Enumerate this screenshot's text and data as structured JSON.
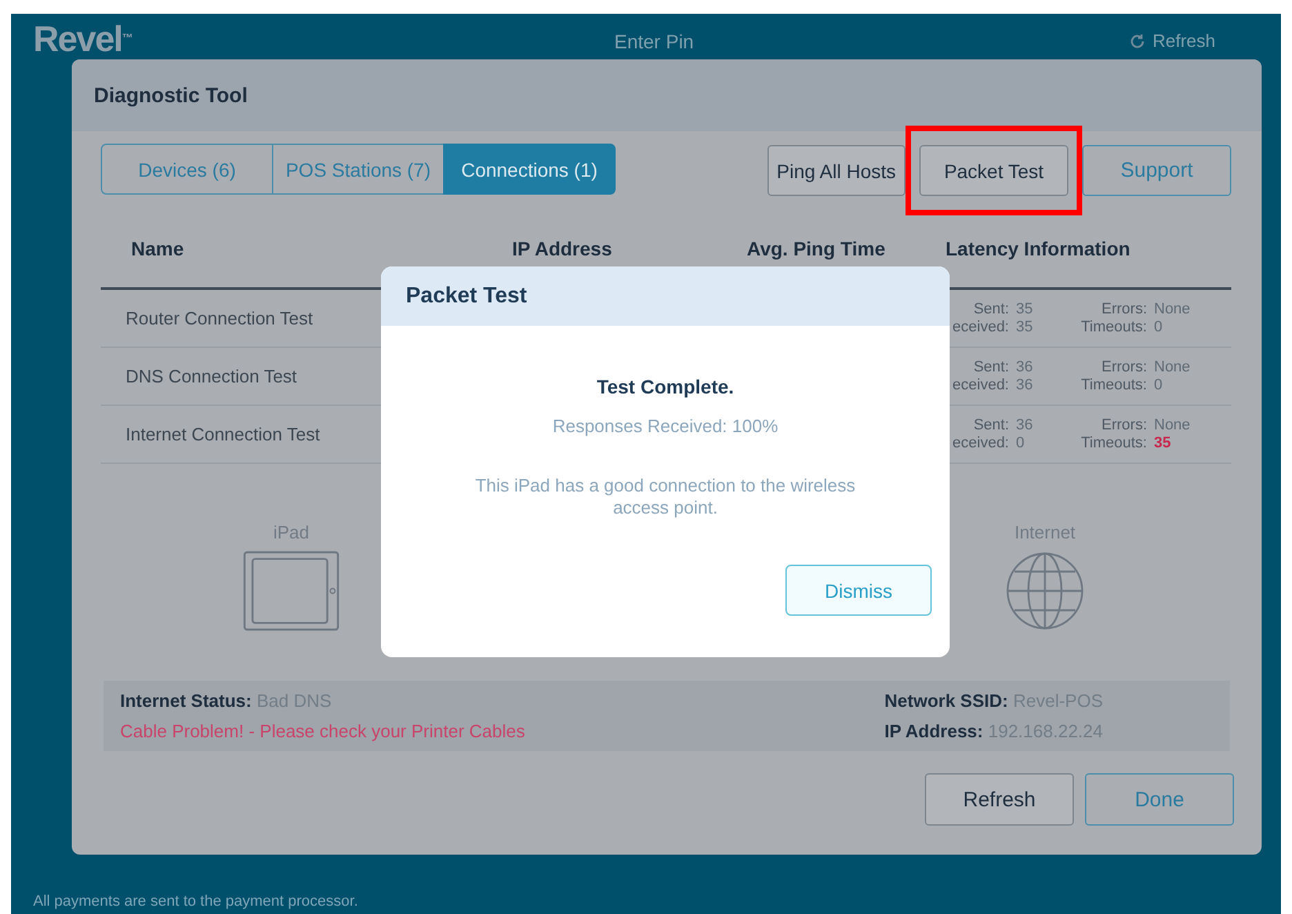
{
  "background": {
    "logo": "Revel",
    "logo_mark": "™",
    "title": "Enter Pin",
    "refresh": "Refresh",
    "footer": "All payments are sent to the payment processor."
  },
  "panel": {
    "title": "Diagnostic Tool",
    "tabs": [
      {
        "label": "Devices (6)",
        "selected": false
      },
      {
        "label": "POS Stations (7)",
        "selected": false
      },
      {
        "label": "Connections (1)",
        "selected": true
      }
    ],
    "actions": [
      {
        "label": "Ping All Hosts",
        "kind": "secondary",
        "highlighted": false
      },
      {
        "label": "Packet Test",
        "kind": "secondary",
        "highlighted": true
      },
      {
        "label": "Support",
        "kind": "primary",
        "highlighted": false
      }
    ]
  },
  "table": {
    "columns": [
      "Name",
      "IP Address",
      "Avg. Ping Time",
      "Latency Information"
    ],
    "rows": [
      {
        "name": "Router Connection Test",
        "sent_label": "Sent:",
        "sent": "35",
        "received_label": "eceived:",
        "received": "35",
        "errors_label": "Errors:",
        "errors": "None",
        "timeouts_label": "Timeouts:",
        "timeouts": "0",
        "timeouts_alert": false
      },
      {
        "name": "DNS Connection Test",
        "sent_label": "Sent:",
        "sent": "36",
        "received_label": "eceived:",
        "received": "36",
        "errors_label": "Errors:",
        "errors": "None",
        "timeouts_label": "Timeouts:",
        "timeouts": "0",
        "timeouts_alert": false
      },
      {
        "name": "Internet Connection Test",
        "sent_label": "Sent:",
        "sent": "36",
        "received_label": "eceived:",
        "received": "0",
        "errors_label": "Errors:",
        "errors": "None",
        "timeouts_label": "Timeouts:",
        "timeouts": "35",
        "timeouts_alert": true
      }
    ]
  },
  "devices": [
    {
      "label": "iPad",
      "kind": "tablet"
    },
    {
      "label": "Internet",
      "kind": "globe"
    }
  ],
  "status": {
    "internet_label": "Internet Status:",
    "internet_value": "Bad DNS",
    "message": "Cable Problem! - Please check your  Printer Cables",
    "ssid_label": "Network SSID:",
    "ssid_value": "Revel-POS",
    "ip_label": "IP Address:",
    "ip_value": "192.168.22.24"
  },
  "buttons": [
    {
      "label": "Refresh",
      "kind": "secondary"
    },
    {
      "label": "Done",
      "kind": "primary"
    }
  ],
  "dialog": {
    "title": "Packet Test",
    "heading": "Test Complete.",
    "result": "Responses Received: 100%",
    "message": "This iPad has a good connection to the wireless access point.",
    "button": "Dismiss"
  }
}
